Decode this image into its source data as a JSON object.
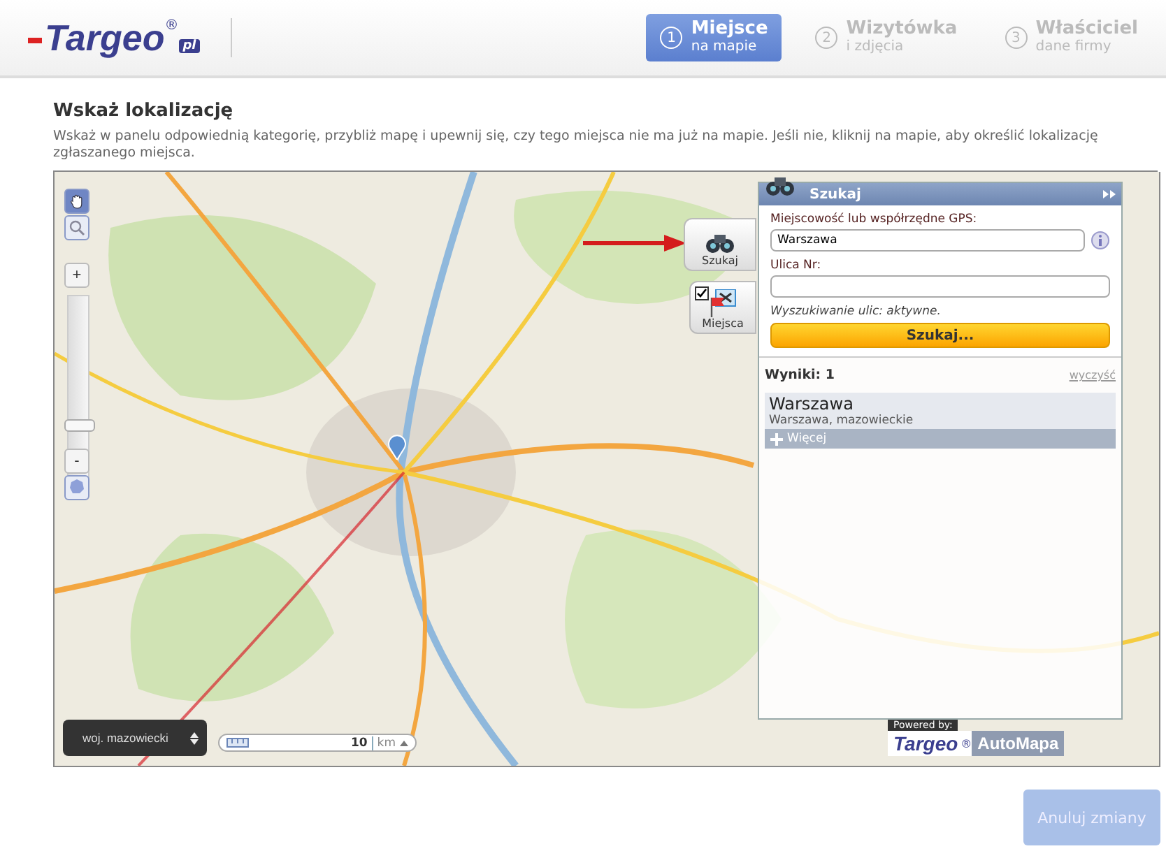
{
  "header": {
    "logo": {
      "brand": "Targeo",
      "mark": "®",
      "suffix": "pl"
    },
    "steps": [
      {
        "number": "1",
        "title": "Miejsce",
        "subtitle": "na mapie",
        "selected": true
      },
      {
        "number": "2",
        "title": "Wizytówka",
        "subtitle": "i zdjęcia",
        "selected": false
      },
      {
        "number": "3",
        "title": "Właściciel",
        "subtitle": "dane firmy",
        "selected": false
      }
    ]
  },
  "page": {
    "title": "Wskaż lokalizację",
    "description": "Wskaż w panelu odpowiednią kategorię, przybliż mapę i upewnij się, czy tego miejsca nie ma już na mapie. Jeśli nie, kliknij na mapie, aby określić lokalizację zgłaszanego miejsca."
  },
  "map": {
    "kind": "picture",
    "tools": [
      {
        "kind": "pan",
        "selected": true
      },
      {
        "kind": "zoom-box",
        "selected": false
      }
    ],
    "zoom": {
      "plus": "+",
      "minus": "-",
      "level": 0.3
    },
    "side_buttons": [
      {
        "kind": "search",
        "label": "Szukaj"
      },
      {
        "kind": "places",
        "label": "Miejsca",
        "checked": true
      }
    ],
    "region": "woj. mazowiecki",
    "scale": {
      "value": "10",
      "unit": "km"
    },
    "attribution": {
      "powered": "Powered by:",
      "brand": "Targeo",
      "mark": "®",
      "partner": "AutoMapa"
    },
    "search_panel": {
      "title": "Szukaj",
      "fields": [
        {
          "label": "Miejscowość lub współrzędne GPS:",
          "value": "Warszawa",
          "info": true
        },
        {
          "label": "Ulica Nr:",
          "info": false
        }
      ],
      "note": "Wyszukiwanie ulic: aktywne.",
      "button": "Szukaj...",
      "results_label": "Wyniki: 1",
      "clear": "wyczyść",
      "results": [
        {
          "name": "Warszawa",
          "detail": "Warszawa, mazowieckie",
          "more": "Więcej"
        }
      ]
    }
  },
  "footer": {
    "cancel": {
      "label": "Anuluj zmiany",
      "disabled": true
    }
  }
}
